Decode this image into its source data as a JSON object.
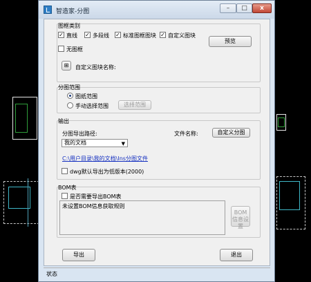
{
  "window": {
    "title": "智造家-分图",
    "minimize_glyph": "–",
    "maximize_glyph": "□",
    "close_glyph": "x"
  },
  "block_category": {
    "label": "图框类别",
    "options": [
      {
        "label": "直线",
        "checked": true
      },
      {
        "label": "多段线",
        "checked": true
      },
      {
        "label": "标准图框图块",
        "checked": true
      },
      {
        "label": "自定义图块",
        "checked": true
      }
    ],
    "no_frame": {
      "label": "无图框",
      "checked": false
    },
    "preview_button": "预览",
    "custom_block_name_label": "自定义图块名称:",
    "custom_block_icon": "block-pick-icon"
  },
  "split_range": {
    "label": "分图范围",
    "options": [
      {
        "label": "图纸范围",
        "selected": true
      },
      {
        "label": "手动选择范围",
        "selected": false
      }
    ],
    "select_range_button": "选择范围"
  },
  "output": {
    "label": "输出",
    "path_label": "分图导出路径:",
    "path_selected": "我的文档",
    "file_name_label": "文件名称:",
    "custom_split_button": "自定义分图",
    "path_link": "C:\\用户目录\\我的文档\\Ins分图文件",
    "dwg_low_version": {
      "label": "dwg默认导出为低版本(2000)",
      "checked": false
    }
  },
  "bom": {
    "label": "BOM表",
    "export_bom": {
      "label": "是否需要导出BOM表",
      "checked": false
    },
    "info_text": "未设置BOM信息获取规则",
    "settings_button": "BOM信息设置"
  },
  "actions": {
    "export": "导出",
    "exit": "退出"
  },
  "status": "状态",
  "colors": {
    "client_bg": "#f0f0f0",
    "window_frame": "#d9e5f2",
    "cad_bg": "#000000",
    "link": "#1530c0"
  }
}
